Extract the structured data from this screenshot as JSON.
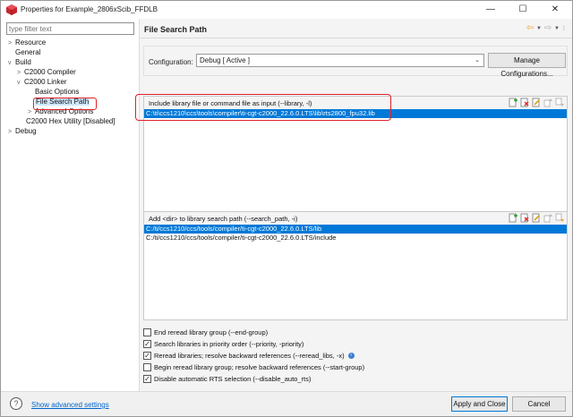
{
  "window": {
    "title": "Properties for Example_2806xScib_FFDLB",
    "minimize": "—",
    "maximize": "☐",
    "close": "✕"
  },
  "sidebar": {
    "filter_placeholder": "type filter text",
    "items": [
      {
        "label": "Resource",
        "arrow": ">"
      },
      {
        "label": "General",
        "arrow": ""
      },
      {
        "label": "Build",
        "arrow": "v"
      },
      {
        "label": "C2000 Compiler",
        "arrow": ">"
      },
      {
        "label": "C2000 Linker",
        "arrow": "v"
      },
      {
        "label": "Basic Options",
        "arrow": ""
      },
      {
        "label": "File Search Path",
        "arrow": ""
      },
      {
        "label": "Advanced Options",
        "arrow": ">"
      },
      {
        "label": "C2000 Hex Utility  [Disabled]",
        "arrow": ""
      },
      {
        "label": "Debug",
        "arrow": ">"
      }
    ]
  },
  "page": {
    "title": "File Search Path"
  },
  "configuration": {
    "label": "Configuration:",
    "value": "Debug  [ Active ]",
    "manage_label": "Manage Configurations..."
  },
  "library_group": {
    "title": "Include library file or command file as input (--library, -l)",
    "rows": [
      "C:\\ti\\ccs1210\\ccs\\tools\\compiler\\ti-cgt-c2000_22.6.0.LTS\\lib\\rts2800_fpu32.lib"
    ]
  },
  "search_path_group": {
    "title": "Add <dir> to library search path (--search_path, -i)",
    "rows": [
      "C:/ti/ccs1210/ccs/tools/compiler/ti-cgt-c2000_22.6.0.LTS/lib",
      "C:/ti/ccs1210/ccs/tools/compiler/ti-cgt-c2000_22.6.0.LTS/include"
    ]
  },
  "options": [
    {
      "label": "End reread library group (--end-group)",
      "checked": false
    },
    {
      "label": "Search libraries in priority order (--priority, -priority)",
      "checked": true
    },
    {
      "label": "Reread libraries; resolve backward references (--reread_libs, -x)",
      "checked": true
    },
    {
      "label": "Begin reread library group; resolve backward references (--start-group)",
      "checked": false
    },
    {
      "label": "Disable automatic RTS selection (--disable_auto_rts)",
      "checked": true
    }
  ],
  "footer": {
    "show_advanced": "Show advanced settings",
    "apply_close": "Apply and Close",
    "cancel": "Cancel"
  },
  "colors": {
    "selection": "#0078d7",
    "highlight_box": "#e0202a",
    "link": "#0066cc"
  }
}
